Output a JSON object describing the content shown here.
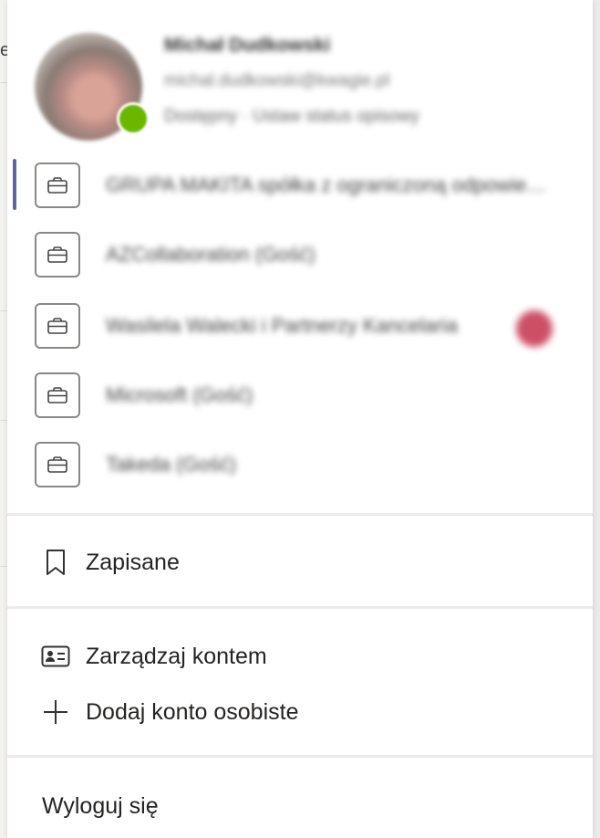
{
  "background": {
    "peek_letter": "e"
  },
  "profile": {
    "name": "Michał Dudkowski",
    "email": "michal.dudkowski@kwagie.pl",
    "status": "Dostępny · Ustaw status opisowy"
  },
  "organizations": [
    {
      "label": "GRUPA MAKITA spółka z ograniczoną odpowiedzialnością",
      "active": true,
      "badge": false
    },
    {
      "label": "AZCollaboration (Gość)",
      "active": false,
      "badge": false
    },
    {
      "label": "Wasilela Walecki i Partnerzy Kancelaria",
      "active": false,
      "badge": true
    },
    {
      "label": "Microsoft (Gość)",
      "active": false,
      "badge": false
    },
    {
      "label": "Takeda (Gość)",
      "active": false,
      "badge": false
    }
  ],
  "menu": {
    "saved": "Zapisane",
    "manage_account": "Zarządzaj kontem",
    "add_personal": "Dodaj konto osobiste",
    "sign_out": "Wyloguj się"
  },
  "colors": {
    "accent": "#6264a7",
    "presence": "#6bb700",
    "badge": "#c4314b",
    "divider": "#ebebeb"
  }
}
